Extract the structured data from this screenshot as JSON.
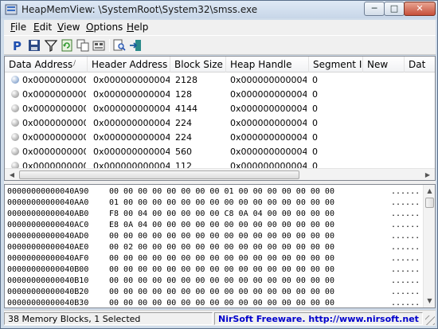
{
  "window": {
    "title": "HeapMemView:  \\SystemRoot\\System32\\smss.exe",
    "minimize_glyph": "─",
    "maximize_glyph": "□",
    "close_glyph": "✕"
  },
  "menu": [
    "File",
    "Edit",
    "View",
    "Options",
    "Help"
  ],
  "toolbar": {
    "icons": [
      "properties-p-icon",
      "save-icon",
      "filter-icon",
      "refresh-icon",
      "copy-icon",
      "html-report-icon",
      "find-icon",
      "exit-icon"
    ]
  },
  "list": {
    "columns": [
      "Data Address",
      "Header Address",
      "Block Size",
      "Heap Handle",
      "Segment I...",
      "New",
      "Dat"
    ],
    "sort_indicator": "/",
    "rows": [
      {
        "data_address": "0x0000000000...",
        "header_address": "0x000000000004...",
        "block_size": "2128",
        "heap_handle": "0x000000000004...",
        "segment": "0"
      },
      {
        "data_address": "0x0000000000...",
        "header_address": "0x000000000004...",
        "block_size": "128",
        "heap_handle": "0x000000000004...",
        "segment": "0"
      },
      {
        "data_address": "0x0000000000...",
        "header_address": "0x000000000004...",
        "block_size": "4144",
        "heap_handle": "0x000000000004...",
        "segment": "0"
      },
      {
        "data_address": "0x0000000000...",
        "header_address": "0x000000000004...",
        "block_size": "224",
        "heap_handle": "0x000000000004...",
        "segment": "0"
      },
      {
        "data_address": "0x0000000000...",
        "header_address": "0x000000000004...",
        "block_size": "224",
        "heap_handle": "0x000000000004...",
        "segment": "0"
      },
      {
        "data_address": "0x0000000000...",
        "header_address": "0x000000000004...",
        "block_size": "560",
        "heap_handle": "0x000000000004...",
        "segment": "0"
      },
      {
        "data_address": "0x0000000000...",
        "header_address": "0x000000000004...",
        "block_size": "112",
        "heap_handle": "0x000000000004...",
        "segment": "0"
      }
    ]
  },
  "hex": [
    {
      "addr": "00000000000040A90",
      "bytes": "00 00 00 00 00 00 00 00 01 00 00 00 00 00 00 00",
      "ascii": "......"
    },
    {
      "addr": "00000000000040AA0",
      "bytes": "01 00 00 00 00 00 00 00 00 00 00 00 00 00 00 00",
      "ascii": "......"
    },
    {
      "addr": "00000000000040AB0",
      "bytes": "F8 00 04 00 00 00 00 00 C8 0A 04 00 00 00 00 00",
      "ascii": "......"
    },
    {
      "addr": "00000000000040AC0",
      "bytes": "E8 0A 04 00 00 00 00 00 00 00 00 00 00 00 00 00",
      "ascii": "......"
    },
    {
      "addr": "00000000000040AD0",
      "bytes": "00 00 00 00 00 00 00 00 00 00 00 00 00 00 00 00",
      "ascii": "......"
    },
    {
      "addr": "00000000000040AE0",
      "bytes": "00 02 00 00 00 00 00 00 00 00 00 00 00 00 00 00",
      "ascii": "......"
    },
    {
      "addr": "00000000000040AF0",
      "bytes": "00 00 00 00 00 00 00 00 00 00 00 00 00 00 00 00",
      "ascii": "......"
    },
    {
      "addr": "00000000000040B00",
      "bytes": "00 00 00 00 00 00 00 00 00 00 00 00 00 00 00 00",
      "ascii": "......"
    },
    {
      "addr": "00000000000040B10",
      "bytes": "00 00 00 00 00 00 00 00 00 00 00 00 00 00 00 00",
      "ascii": "......"
    },
    {
      "addr": "00000000000040B20",
      "bytes": "00 00 00 00 00 00 00 00 00 00 00 00 00 00 00 00",
      "ascii": "......"
    },
    {
      "addr": "00000000000040B30",
      "bytes": "00 00 00 00 00 00 00 00 00 00 00 00 00 00 00 00",
      "ascii": "......"
    }
  ],
  "status": {
    "count": "38 Memory Blocks, 1 Selected",
    "link": "NirSoft Freeware.  http://www.nirsoft.net"
  },
  "colors": {
    "link": "#0000cc",
    "accent": "#1f4fb0"
  }
}
